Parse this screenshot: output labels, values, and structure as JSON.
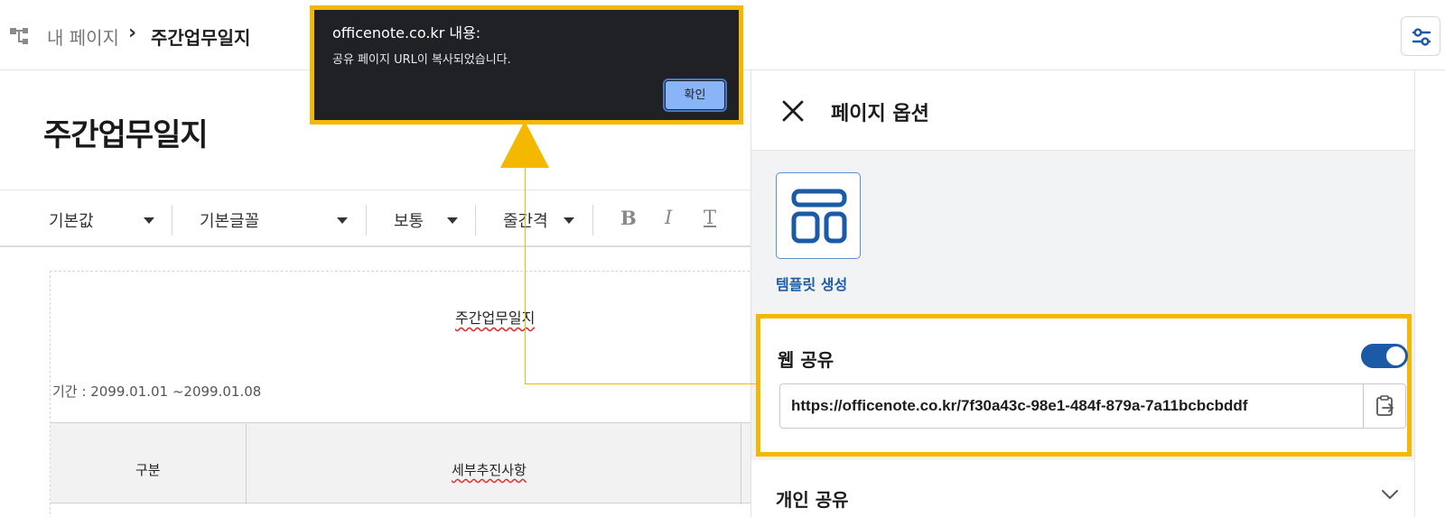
{
  "breadcrumb": {
    "parent": "내 페이지",
    "separator": "›",
    "current": "주간업무일지"
  },
  "page": {
    "title": "주간업무일지"
  },
  "toolbar": {
    "style_select": "기본값",
    "font_select": "기본글꼴",
    "size_select": "보통",
    "line_spacing_select": "줄간격",
    "bold_label": "B",
    "italic_label": "I",
    "text_label": "T"
  },
  "document": {
    "title": "주간업무일지",
    "period": "기간 : 2099.01.01  ~2099.01.08",
    "table_headers": [
      "구분",
      "세부추진사항"
    ]
  },
  "alert": {
    "origin": "officenote.co.kr 내용:",
    "message": "공유 페이지 URL이 복사되었습니다.",
    "ok_label": "확인"
  },
  "panel": {
    "title": "페이지 옵션",
    "template_label": "템플릿 생성",
    "web_share": {
      "title": "웹 공유",
      "enabled": true,
      "url": "https://officenote.co.kr/7f30a43c-98e1-484f-879a-7a11bcbcbddf"
    },
    "personal_share_title": "개인 공유"
  },
  "colors": {
    "highlight": "#f5b800",
    "accent": "#1a5aa6",
    "dialog_bg": "#202124",
    "dialog_button": "#8ab4f8"
  }
}
